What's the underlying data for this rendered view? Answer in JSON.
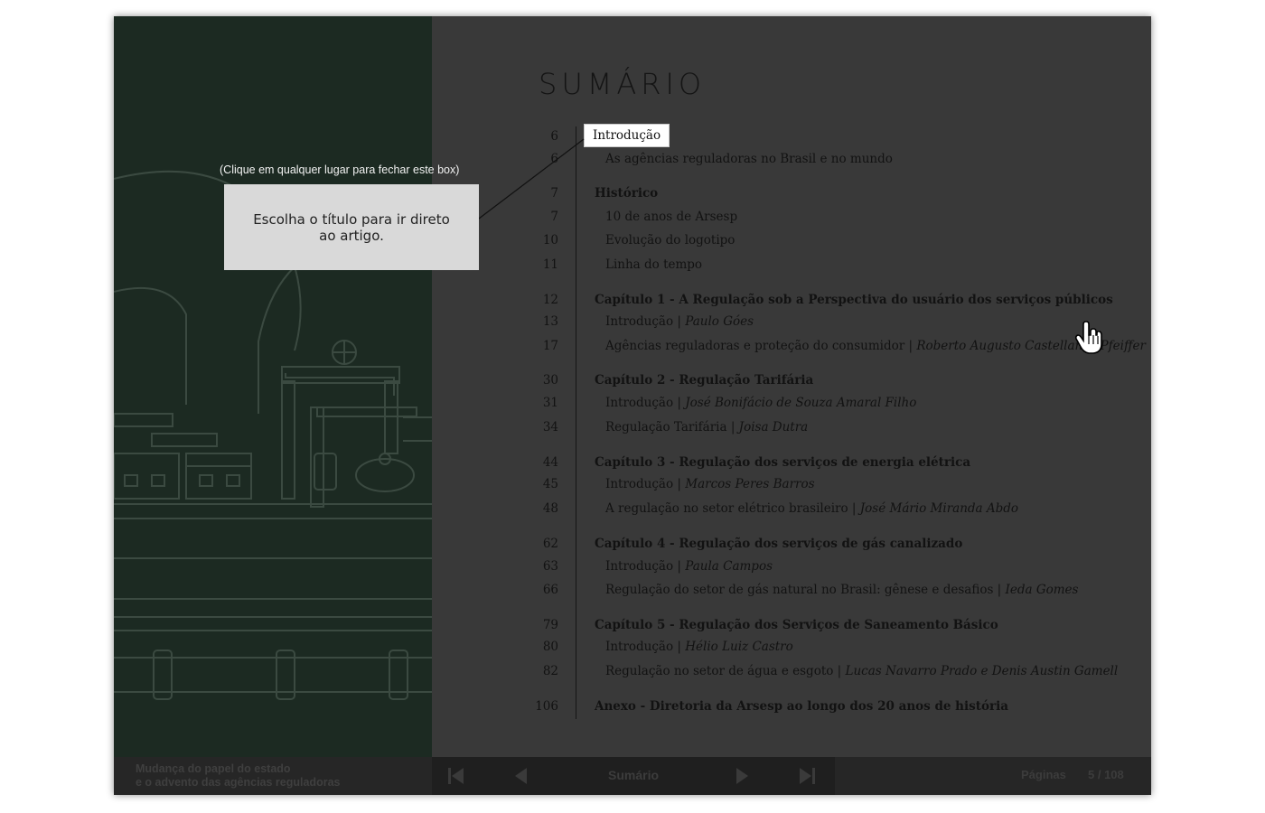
{
  "toc": {
    "title": "SUMÁRIO",
    "rows": [
      {
        "num": "6",
        "text": "Introdução",
        "kind": "highlight"
      },
      {
        "num": "6",
        "text": "As agências reguladoras no Brasil e no mundo",
        "kind": "sub"
      },
      {
        "num": "7",
        "text": "Histórico",
        "kind": "ch"
      },
      {
        "num": "7",
        "text": "10 de anos de Arsesp",
        "kind": "sub"
      },
      {
        "num": "10",
        "text": "Evolução do logotipo",
        "kind": "sub"
      },
      {
        "num": "11",
        "text": "Linha do tempo",
        "kind": "sub"
      },
      {
        "num": "12",
        "text": "Capítulo 1 - A Regulação sob a Perspectiva do usuário dos serviços públicos",
        "kind": "ch"
      },
      {
        "num": "13",
        "text": "Introdução | ",
        "author": "Paulo Góes",
        "kind": "sub"
      },
      {
        "num": "17",
        "text": "Agências reguladoras e proteção do consumidor | ",
        "author": "Roberto Augusto Castellanos Pfeiffer",
        "kind": "sub"
      },
      {
        "num": "30",
        "text": "Capítulo 2 - Regulação Tarifária",
        "kind": "ch"
      },
      {
        "num": "31",
        "text": "Introdução | ",
        "author": "José Bonifácio de Souza Amaral Filho",
        "kind": "sub"
      },
      {
        "num": "34",
        "text": "Regulação Tarifária | ",
        "author": "Joisa Dutra",
        "kind": "sub"
      },
      {
        "num": "44",
        "text": "Capítulo 3 - Regulação dos serviços de energia elétrica",
        "kind": "ch"
      },
      {
        "num": "45",
        "text": "Introdução | ",
        "author": "Marcos Peres Barros",
        "kind": "sub"
      },
      {
        "num": "48",
        "text": "A regulação no setor elétrico brasileiro | ",
        "author": "José Mário Miranda Abdo",
        "kind": "sub"
      },
      {
        "num": "62",
        "text": "Capítulo 4 - Regulação dos serviços de gás canalizado",
        "kind": "ch"
      },
      {
        "num": "63",
        "text": "Introdução | ",
        "author": "Paula Campos",
        "kind": "sub"
      },
      {
        "num": "66",
        "text": "Regulação do setor de gás natural no Brasil: gênese e desafios | ",
        "author": "Ieda Gomes",
        "kind": "sub"
      },
      {
        "num": "79",
        "text": "Capítulo 5 - Regulação dos Serviços de Saneamento Básico",
        "kind": "ch"
      },
      {
        "num": "80",
        "text": "Introdução | ",
        "author": "Hélio Luiz Castro",
        "kind": "sub"
      },
      {
        "num": "82",
        "text": "Regulação no setor de água e esgoto | ",
        "author": "Lucas Navarro Prado e Denis Austin Gamell",
        "kind": "sub"
      },
      {
        "num": "106",
        "text": "Anexo - Diretoria da Arsesp ao longo dos 20 anos de história",
        "kind": "ch"
      }
    ]
  },
  "tooltip": {
    "hint": "(Clique em qualquer lugar para fechar este box)",
    "message": "Escolha o título para ir direto ao artigo."
  },
  "bottom_bar": {
    "caption_line1": "Mudança do papel do estado",
    "caption_line2": "e o advento das agências reguladoras",
    "nav_label": "Sumário",
    "pages_label": "Páginas",
    "pages_count": "5 / 108",
    "icons": [
      "first-page-icon",
      "previous-page-icon",
      "next-page-icon",
      "last-page-icon"
    ]
  },
  "colors": {
    "left_page_bg": "#1c2a22",
    "right_page_bg": "#393939",
    "bar_bg": "#262626"
  }
}
